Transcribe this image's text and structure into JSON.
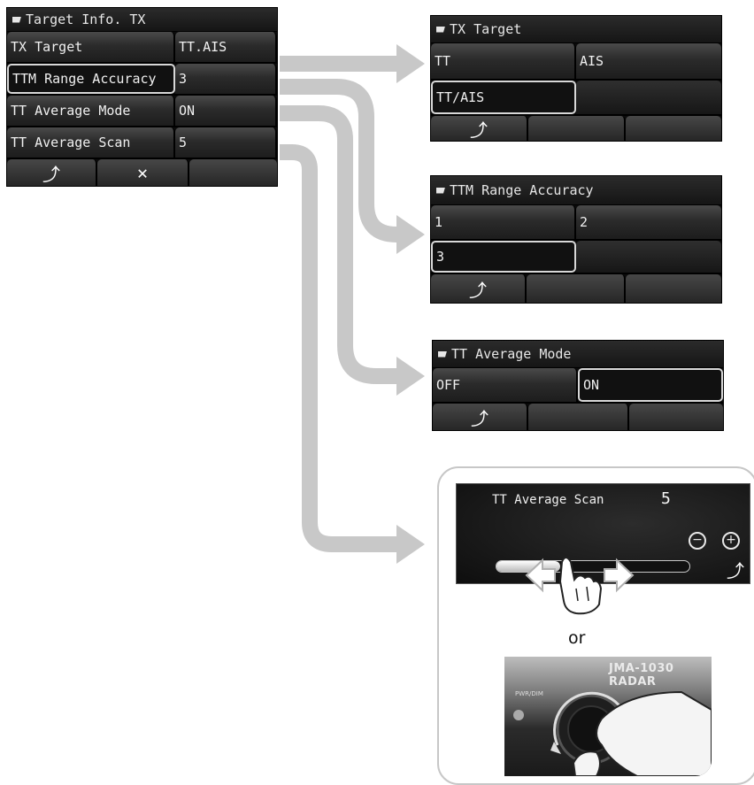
{
  "main_menu": {
    "title": "Target Info. TX",
    "rows": [
      {
        "label": "TX Target",
        "value": "TT.AIS"
      },
      {
        "label": "TTM Range Accuracy",
        "value": "3"
      },
      {
        "label": "TT Average Mode",
        "value": "ON"
      },
      {
        "label": "TT Average Scan",
        "value": "5"
      }
    ],
    "bottom": {
      "back": "⤴",
      "close": "✕"
    }
  },
  "tx_target": {
    "title": "TX Target",
    "options": [
      "TT",
      "AIS",
      "TT/AIS"
    ],
    "back": "⤴"
  },
  "ttm_range": {
    "title": "TTM Range Accuracy",
    "options": [
      "1",
      "2",
      "3"
    ],
    "back": "⤴"
  },
  "tt_avg_mode": {
    "title": "TT Average Mode",
    "options": [
      "OFF",
      "ON"
    ],
    "back": "⤴"
  },
  "tt_avg_scan": {
    "title": "TT Average Scan",
    "value": "5",
    "minus": "−",
    "plus": "+",
    "back": "⤴",
    "slider_fraction": 0.33
  },
  "or_text": "or",
  "knob_photo": {
    "label": "JMA-1030 RADAR",
    "small_label": "PWR/DIM"
  },
  "colors": {
    "arrow": "#c8c8c8",
    "panel_bg": "#0c0c0c",
    "text": "#f0f0f0"
  }
}
